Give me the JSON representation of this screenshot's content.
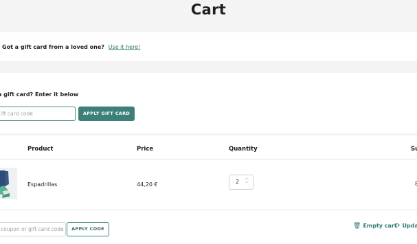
{
  "page": {
    "title": "Cart"
  },
  "gift_notice": {
    "text": "Got a gift card from a loved one?",
    "link": "Use it here!"
  },
  "gift_card": {
    "label": "a gift card? Enter it below",
    "placeholder": "ift card code",
    "apply_label": "APPLY GIFT CARD"
  },
  "table": {
    "headers": {
      "product": "Product",
      "price": "Price",
      "quantity": "Quantity",
      "subtotal": "Su"
    },
    "rows": [
      {
        "product": "Espadrillas",
        "price": "44,20 €",
        "quantity": "2",
        "subtotal": "8"
      }
    ]
  },
  "actions": {
    "coupon_placeholder": "coupon or gift card code",
    "apply_code_label": "APPLY CODE",
    "empty_cart_label": "Empty cart",
    "update_label": "Upda"
  },
  "icons": {
    "empty": "trash-icon",
    "update": "refresh-icon",
    "qty": "stepper-arrows-icon"
  },
  "colors": {
    "accent": "#3c8078",
    "link": "#2f7a72"
  }
}
